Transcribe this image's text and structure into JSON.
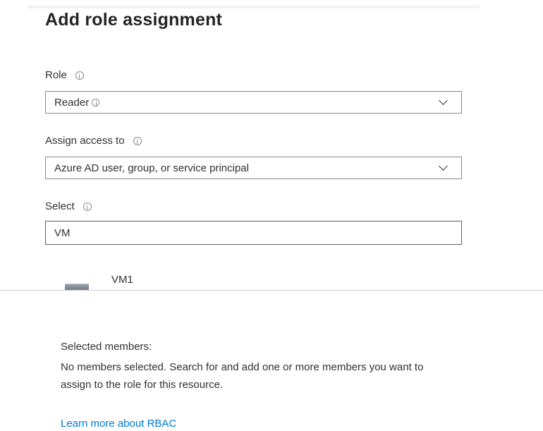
{
  "panel": {
    "title": "Add role assignment"
  },
  "role": {
    "label": "Role",
    "value": "Reader"
  },
  "assign_access": {
    "label": "Assign access to",
    "value": "Azure AD user, group, or service principal"
  },
  "select": {
    "label": "Select",
    "value": "VM"
  },
  "results": [
    {
      "name": "VM1",
      "icon": "virtual-machine-icon"
    }
  ],
  "selected_members": {
    "heading": "Selected members:",
    "message": "No members selected. Search for and add one or more members you want to assign to the role for this resource."
  },
  "links": {
    "learn_more": "Learn more about RBAC"
  },
  "colors": {
    "link": "#0078d4",
    "text": "#323130",
    "border": "#8a8886"
  }
}
